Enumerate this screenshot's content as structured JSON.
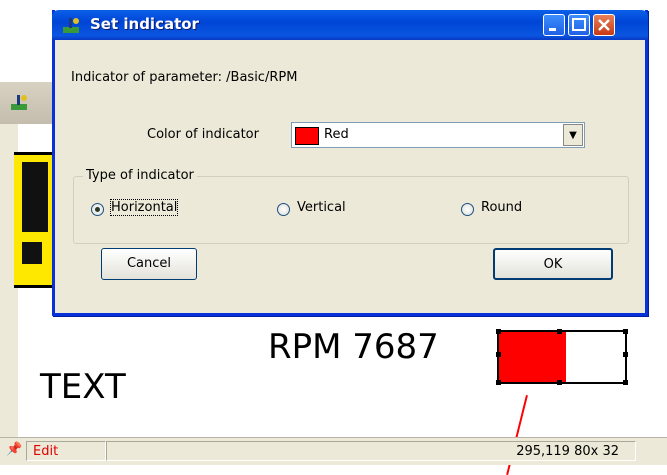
{
  "dialog": {
    "title": "Set indicator",
    "parameter_label": "Indicator of parameter: /Basic/RPM",
    "color_label": "Color of indicator",
    "color_value": "Red",
    "color_swatch": "#ff0000",
    "type_group_label": "Type of indicator",
    "types": [
      {
        "label": "Horizontal",
        "checked": true
      },
      {
        "label": "Vertical",
        "checked": false
      },
      {
        "label": "Round",
        "checked": false
      }
    ],
    "cancel_label": "Cancel",
    "ok_label": "OK"
  },
  "canvas": {
    "rpm_label": "RPM  7687",
    "text_label": "TEXT",
    "indicator_fill_fraction": 0.53,
    "indicator_color": "#ff0000"
  },
  "statusbar": {
    "mode": "Edit",
    "coords": "295,119  80x 32"
  },
  "icons": {
    "title_icon": "pump-icon",
    "pin": "pin-icon"
  },
  "colors": {
    "titlebar": "#0a5fe8",
    "dialog_bg": "#ece9d8",
    "status_edit": "#e00000"
  }
}
